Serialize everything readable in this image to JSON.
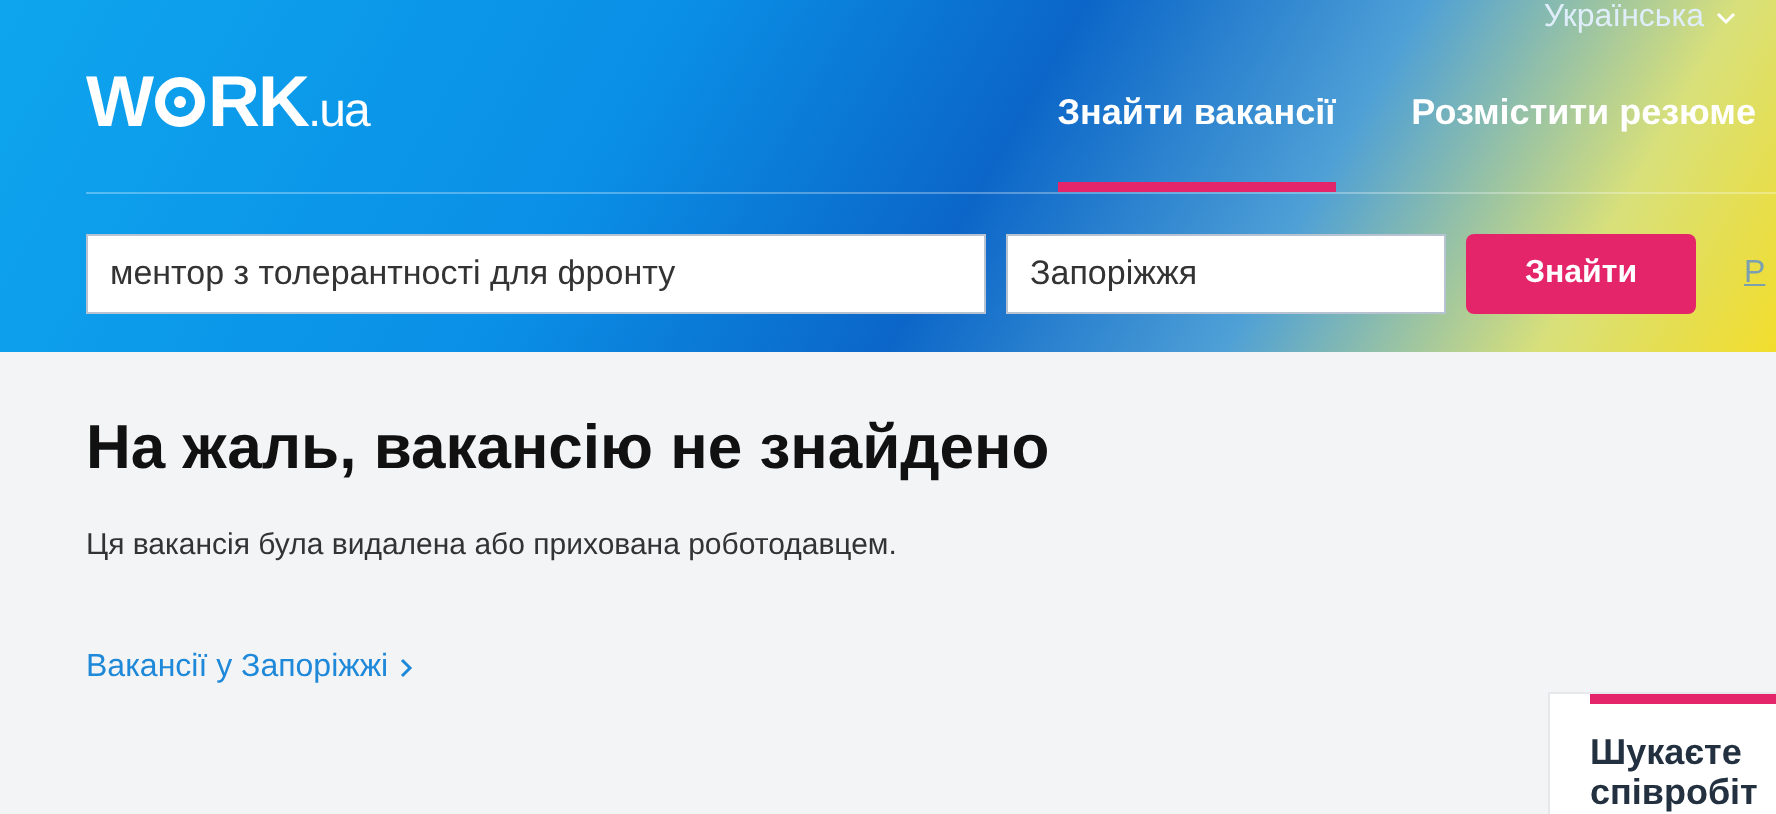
{
  "language": {
    "label": "Українська"
  },
  "logo": {
    "text_start": "W",
    "text_end": "RK",
    "suffix": ".ua"
  },
  "nav": [
    {
      "label": "Знайти вакансії",
      "selected": true
    },
    {
      "label": "Розмістити резюме",
      "selected": false
    }
  ],
  "search": {
    "query": "ментор з толерантності для фронту",
    "city": "Запоріжжя",
    "button": "Знайти",
    "link": "Р"
  },
  "message": {
    "title": "На жаль, вакансію не знайдено",
    "text": "Ця вакансія була видалена або прихована роботодавцем.",
    "link": "Вакансії у Запоріжжі"
  },
  "promo": {
    "title": "Шукаєте співробіт"
  }
}
